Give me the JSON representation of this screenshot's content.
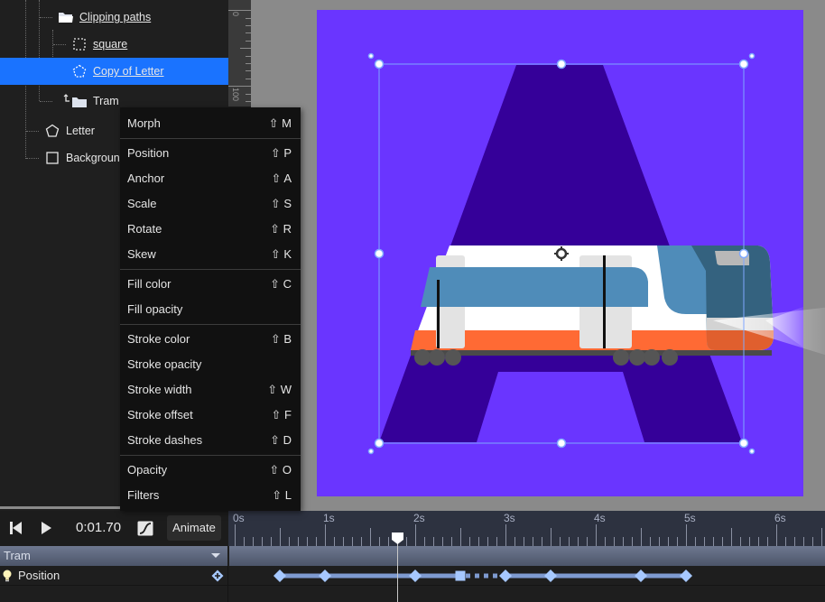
{
  "layers": {
    "items": [
      {
        "label": "Clipping paths",
        "icon": "folder-open-icon",
        "underline": true,
        "selected": false
      },
      {
        "label": "square",
        "icon": "dashed-square-icon",
        "underline": true,
        "selected": false
      },
      {
        "label": "Copy of Letter",
        "icon": "dashed-pentagon-icon",
        "underline": true,
        "selected": true
      },
      {
        "label": "Tram",
        "icon": "folder-linked-icon",
        "underline": false,
        "selected": false
      },
      {
        "label": "Letter",
        "icon": "pentagon-icon",
        "underline": false,
        "selected": false
      },
      {
        "label": "Background",
        "icon": "square-icon",
        "underline": false,
        "selected": false
      }
    ]
  },
  "ruler": {
    "vertical_labels": [
      "0",
      "100"
    ]
  },
  "context_menu": {
    "items": [
      {
        "label": "Morph",
        "shortcut": "⇧ M"
      },
      {
        "label": "Position",
        "shortcut": "⇧ P"
      },
      {
        "label": "Anchor",
        "shortcut": "⇧ A"
      },
      {
        "label": "Scale",
        "shortcut": "⇧ S"
      },
      {
        "label": "Rotate",
        "shortcut": "⇧ R"
      },
      {
        "label": "Skew",
        "shortcut": "⇧ K"
      },
      {
        "label": "Fill color",
        "shortcut": "⇧ C"
      },
      {
        "label": "Fill opacity",
        "shortcut": ""
      },
      {
        "label": "Stroke color",
        "shortcut": "⇧ B"
      },
      {
        "label": "Stroke opacity",
        "shortcut": ""
      },
      {
        "label": "Stroke width",
        "shortcut": "⇧ W"
      },
      {
        "label": "Stroke offset",
        "shortcut": "⇧ F"
      },
      {
        "label": "Stroke dashes",
        "shortcut": "⇧ D"
      },
      {
        "label": "Opacity",
        "shortcut": "⇧ O"
      },
      {
        "label": "Filters",
        "shortcut": "⇧ L"
      }
    ]
  },
  "canvas": {
    "colors": {
      "background": "#6a35ff",
      "letter": "#350099",
      "selection": "#7fa8ff"
    }
  },
  "timeline": {
    "time": "0:01.70",
    "animate_label": "Animate",
    "ruler_labels": [
      "0s",
      "1s",
      "2s",
      "3s",
      "4s",
      "5s",
      "6s"
    ],
    "playhead_seconds": 1.8,
    "group_label": "Tram",
    "property_label": "Position",
    "keyframes_seconds": [
      0.5,
      1.0,
      2.0,
      3.0,
      3.5,
      4.5,
      5.0
    ],
    "hold_keyframe_seconds": 2.5,
    "colors": {
      "keyframe": "#a6c8ff",
      "track": "#7e9ad0"
    }
  }
}
